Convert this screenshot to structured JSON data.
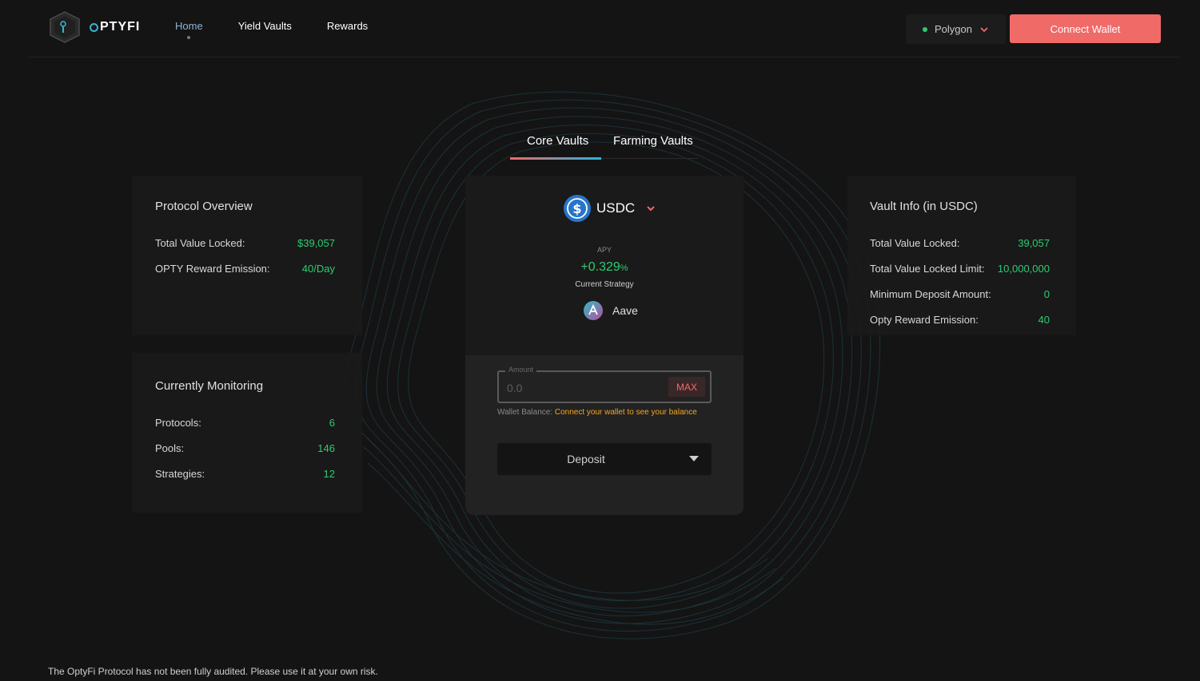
{
  "brand": {
    "logo_text": "PTYFI"
  },
  "nav": {
    "items": [
      {
        "label": "Home",
        "active": true
      },
      {
        "label": "Yield Vaults",
        "active": false
      },
      {
        "label": "Rewards",
        "active": false
      }
    ]
  },
  "network": {
    "label": "Polygon",
    "status_color": "#2ecc71"
  },
  "connect_button": {
    "label": "Connect Wallet",
    "color": "#f06a68"
  },
  "tabs": [
    {
      "label": "Core Vaults",
      "active": true
    },
    {
      "label": "Farming Vaults",
      "active": false
    }
  ],
  "protocol_overview": {
    "title": "Protocol Overview",
    "rows": [
      {
        "label": "Total Value Locked:",
        "value": "$39,057"
      },
      {
        "label": "OPTY Reward Emission:",
        "value": "40/Day"
      }
    ]
  },
  "currently_monitoring": {
    "title": "Currently Monitoring",
    "rows": [
      {
        "label": "Protocols:",
        "value": "6"
      },
      {
        "label": "Pools:",
        "value": "146"
      },
      {
        "label": "Strategies:",
        "value": "12"
      }
    ]
  },
  "vault": {
    "token": "USDC",
    "apy_label": "APY",
    "apy_value": "+0.329",
    "apy_unit": "%",
    "strategy_label": "Current Strategy",
    "strategy_name": "Aave",
    "amount_legend": "Amount",
    "amount_placeholder": "0.0",
    "max_label": "MAX",
    "wallet_balance_label": "Wallet Balance:",
    "wallet_balance_link": "Connect your wallet to see your balance",
    "action_label": "Deposit"
  },
  "vault_info": {
    "title": "Vault Info (in USDC)",
    "rows": [
      {
        "label": "Total Value Locked:",
        "value": "39,057"
      },
      {
        "label": "Total Value Locked Limit:",
        "value": "10,000,000"
      },
      {
        "label": "Minimum Deposit Amount:",
        "value": "0"
      },
      {
        "label": "Opty Reward Emission:",
        "value": "40"
      }
    ]
  },
  "disclaimer": "The OptyFi Protocol has not been fully audited. Please use it at your own risk.",
  "colors": {
    "positive": "#2ecc71",
    "accent": "#f06a68",
    "link": "#f5a623",
    "tab_gradient_end": "#2bb5e0"
  }
}
